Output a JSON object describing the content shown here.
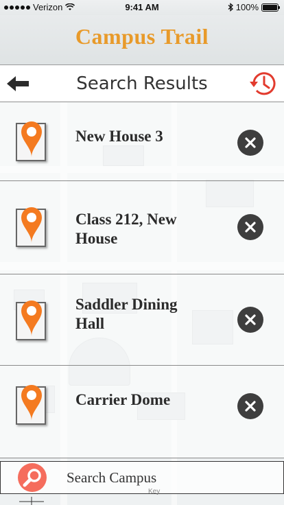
{
  "status_bar": {
    "carrier": "Verizon",
    "time": "9:41 AM",
    "battery": "100%"
  },
  "app": {
    "title": "Campus Trail"
  },
  "header": {
    "title": "Search Results",
    "back_icon": "arrow-left-icon",
    "history_icon": "history-icon"
  },
  "results": [
    {
      "name": "New House 3"
    },
    {
      "name": "Class 212, New House"
    },
    {
      "name": "Saddler Dining Hall"
    },
    {
      "name": "Carrier Dome"
    }
  ],
  "search": {
    "placeholder": "Search Campus"
  },
  "map": {
    "key_label": "Key"
  },
  "colors": {
    "accent": "#e89a2a",
    "pin": "#f47a20",
    "history": "#e23b2e",
    "search_button": "#f56d5d",
    "remove_button": "#3e3e3e"
  }
}
